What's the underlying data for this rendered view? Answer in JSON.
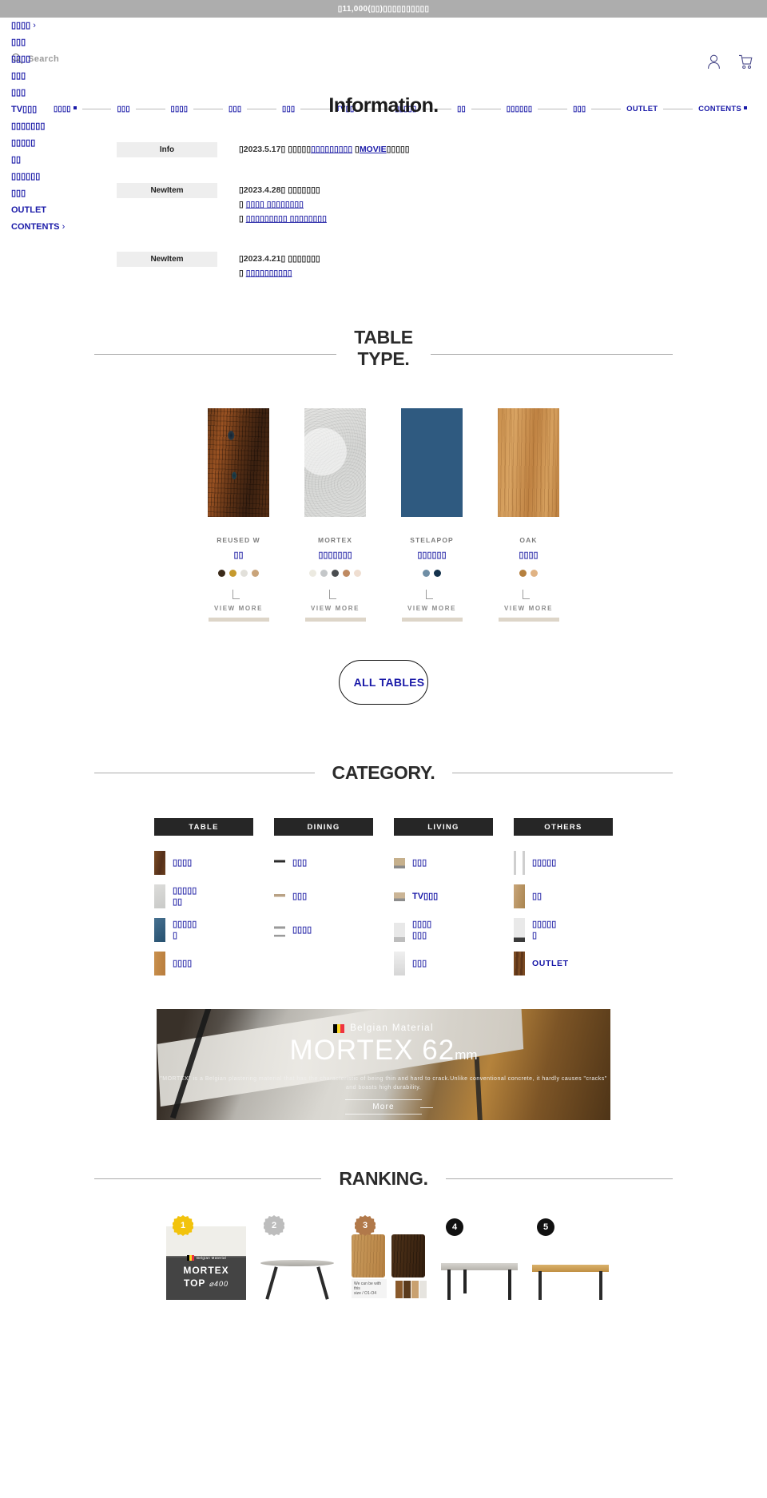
{
  "announce": {
    "text": "▯11,000(▯▯)▯▯▯▯▯▯▯▯▯▯"
  },
  "drawer": {
    "items": [
      {
        "label": "▯▯▯▯",
        "chevron": "›"
      },
      {
        "label": "▯▯▯"
      },
      {
        "label": "▯▯▯▯"
      },
      {
        "label": "▯▯▯"
      },
      {
        "label": "▯▯▯"
      },
      {
        "label": "TV▯▯▯"
      },
      {
        "label": "▯▯▯▯▯▯▯"
      },
      {
        "label": "▯▯▯▯▯"
      },
      {
        "label": "▯▯"
      },
      {
        "label": "▯▯▯▯▯▯"
      },
      {
        "label": "▯▯▯"
      },
      {
        "label": "OUTLET"
      },
      {
        "label": "CONTENTS",
        "chevron": "›"
      }
    ]
  },
  "search": {
    "placeholder": "Search",
    "icon": "search-icon"
  },
  "header_icons": [
    {
      "name": "account-icon"
    },
    {
      "name": "cart-icon"
    }
  ],
  "nav": {
    "heading": "Information.",
    "items": [
      {
        "label": "▯▯▯▯",
        "square": true
      },
      {
        "label": "▯▯▯"
      },
      {
        "label": "▯▯▯▯"
      },
      {
        "label": "▯▯▯"
      },
      {
        "label": "▯▯▯"
      },
      {
        "label": "TV▯▯"
      },
      {
        "label": "▯▯▯▯▯"
      },
      {
        "label": "▯▯"
      },
      {
        "label": "▯▯▯▯▯▯"
      },
      {
        "label": "▯▯▯"
      },
      {
        "label": "OUTLET"
      },
      {
        "label": "CONTENTS",
        "square": true
      }
    ]
  },
  "news": {
    "rows": [
      {
        "tag": "Info",
        "lines": [
          {
            "date": "▯2023.5.17▯",
            "text": "▯▯▯▯▯",
            "link": "▯▯▯▯▯▯▯▯▯",
            "suffix": "▯",
            "movie": "MOVIE",
            "tail": "▯▯▯▯▯"
          }
        ]
      },
      {
        "tag": "NewItem",
        "lines": [
          {
            "date": "▯2023.4.28▯",
            "text": "▯▯▯▯▯▯▯"
          },
          {
            "bullet": "▯",
            "link": "▯▯▯▯ ▯▯▯▯▯▯▯▯"
          },
          {
            "bullet": "▯",
            "link": "▯▯▯▯▯▯▯▯▯ ▯▯▯▯▯▯▯▯"
          }
        ]
      },
      {
        "tag": "NewItem",
        "lines": [
          {
            "date": "▯2023.4.21▯",
            "text": "▯▯▯▯▯▯▯"
          },
          {
            "bullet": "▯",
            "link": "▯▯▯▯▯▯▯▯▯▯"
          }
        ]
      }
    ]
  },
  "table_type": {
    "title": "TABLE\nTYPE.",
    "view_more_label": "VIEW MORE",
    "cards": [
      {
        "name": "REUSED W",
        "subtitle": "▯▯",
        "swatch": "reused-wood-swatch",
        "dots": [
          "#3b2a1a",
          "#c69a2e",
          "#e2e0da",
          "#c9a47a"
        ]
      },
      {
        "name": "MORTEX",
        "subtitle": "▯▯▯▯▯▯▯",
        "swatch": "mortex-swatch",
        "dots": [
          "#eceae1",
          "#c4c7c9",
          "#4a4d50",
          "#bf8a62",
          "#efded1"
        ]
      },
      {
        "name": "STELAPOP",
        "subtitle": "▯▯▯▯▯▯",
        "swatch": "stelapop-swatch",
        "dots": [
          "#6f8ea5",
          "#14324c"
        ]
      },
      {
        "name": "OAK",
        "subtitle": "▯▯▯▯",
        "swatch": "oak-swatch",
        "dots": [
          "#b5803f",
          "#e0b384"
        ]
      }
    ],
    "all_button": "ALL TABLES"
  },
  "category": {
    "title": "CATEGORY.",
    "columns": [
      {
        "button": "TABLE",
        "items": [
          {
            "label": "▯▯▯▯",
            "thumb": "th-wood"
          },
          {
            "label": "▯▯▯▯▯\n▯▯",
            "thumb": "th-mortex"
          },
          {
            "label": "▯▯▯▯▯\n▯",
            "thumb": "th-stela"
          },
          {
            "label": "▯▯▯▯",
            "thumb": "th-oak"
          }
        ]
      },
      {
        "button": "DINING",
        "items": [
          {
            "label": "▯▯▯",
            "thumb": "th-chair"
          },
          {
            "label": "▯▯▯",
            "thumb": "th-desk"
          },
          {
            "label": "▯▯▯▯",
            "thumb": "th-bench"
          }
        ]
      },
      {
        "button": "LIVING",
        "items": [
          {
            "label": "▯▯▯",
            "thumb": "th-sofa"
          },
          {
            "label": "TV▯▯▯",
            "thumb": "th-tvb",
            "en": true
          },
          {
            "label": "▯▯▯▯\n▯▯▯",
            "thumb": "th-lamp"
          },
          {
            "label": "▯▯▯",
            "thumb": "th-rug"
          }
        ]
      },
      {
        "button": "OTHERS",
        "items": [
          {
            "label": "▯▯▯▯▯",
            "thumb": "th-shelf"
          },
          {
            "label": "▯▯",
            "thumb": "th-door"
          },
          {
            "label": "▯▯▯▯▯\n▯",
            "thumb": "th-mirror"
          },
          {
            "label": "OUTLET",
            "thumb": "th-out",
            "out": true
          }
        ]
      }
    ]
  },
  "mortex_banner": {
    "eyebrow": "Belgian Material",
    "flag": [
      "#000000",
      "#fdda24",
      "#ef3340"
    ],
    "title": "MORTEX 62",
    "unit": "mm",
    "description": "\"MORTEX\" is a Belgian plastering material that has the characteristic of being thin and hard to crack.Unlike conventional concrete, it hardly causes \"cracks\" and boasts high durability.",
    "more_label": "More"
  },
  "ranking": {
    "title": "RANKING.",
    "cards": [
      {
        "rank": "1",
        "badge_color": "#f2c30d",
        "product_title": "MORTEX",
        "product_sub": "TOP",
        "product_size": "⌀400",
        "eyebrow": "Belgian Material"
      },
      {
        "rank": "2",
        "badge_color": "#bdbdbd"
      },
      {
        "rank": "3",
        "badge_color": "#b1794a",
        "tag_text": "We can be with this\nsize / O1-O4"
      },
      {
        "rank": "4",
        "badge_color": "#111111"
      },
      {
        "rank": "5",
        "badge_color": "#111111"
      }
    ]
  }
}
